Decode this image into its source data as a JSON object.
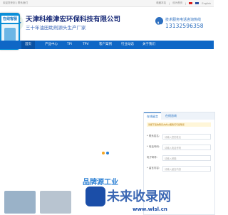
{
  "topbar": {
    "left_text": "欢迎您来到 | 联系我们",
    "links": [
      "收藏本站",
      "|",
      "设为首页",
      "|",
      "English"
    ],
    "flags": [
      "#d7201f",
      "#2a4fa0"
    ]
  },
  "header": {
    "company_name": "天津科维津宏环保科技有限公司",
    "slogan": "三十年油田助剂源头生产厂家",
    "phone_label": "技术服务电话咨询热线",
    "phone_number": "13132596358"
  },
  "badge": {
    "label": "在线客服"
  },
  "nav": {
    "items": [
      "首页",
      "产品中心",
      "TPI",
      "TPV",
      "客户案例",
      "行业动态",
      "关于我们"
    ]
  },
  "loading": {
    "dot_colors": [
      "#f3a521",
      "#2a7fd4"
    ]
  },
  "form": {
    "tabs": [
      "在线留言",
      "在线咨询"
    ],
    "notice": "请留下您的联系方式以便我们与您联系",
    "fields": [
      {
        "label": "* 联系姓名:",
        "placeholder": "请输入您的姓名"
      },
      {
        "label": "* 电话号码:",
        "placeholder": "请输入电话号码"
      },
      {
        "label": "电子邮件:",
        "placeholder": "请输入邮箱"
      },
      {
        "label": "* 留言内容:",
        "placeholder": "请输入留言内容"
      }
    ]
  },
  "bottom": {
    "section_title": "品牌源工业",
    "watermark": "未来收录网",
    "watermark_url": "www.wlsl.cn"
  }
}
